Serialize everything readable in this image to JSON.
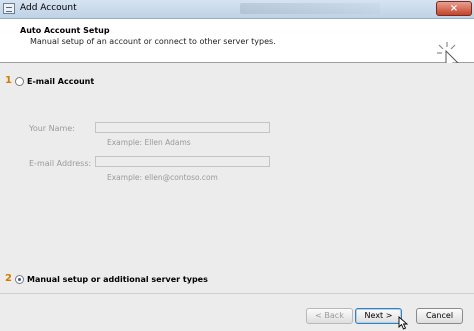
{
  "window": {
    "title": "Add Account",
    "close_label": "×"
  },
  "header": {
    "title": "Auto Account Setup",
    "subtitle": "Manual setup of an account or connect to other server types."
  },
  "options": {
    "email": {
      "step": "1",
      "label": "E-mail Account",
      "selected": false
    },
    "manual": {
      "step": "2",
      "label": "Manual setup or additional server types",
      "selected": true
    }
  },
  "form": {
    "name_label": "Your Name:",
    "name_hint": "Example: Ellen Adams",
    "email_label": "E-mail Address:",
    "email_hint": "Example: ellen@contoso.com"
  },
  "buttons": {
    "back": "< Back",
    "next": "Next >",
    "cancel": "Cancel"
  }
}
